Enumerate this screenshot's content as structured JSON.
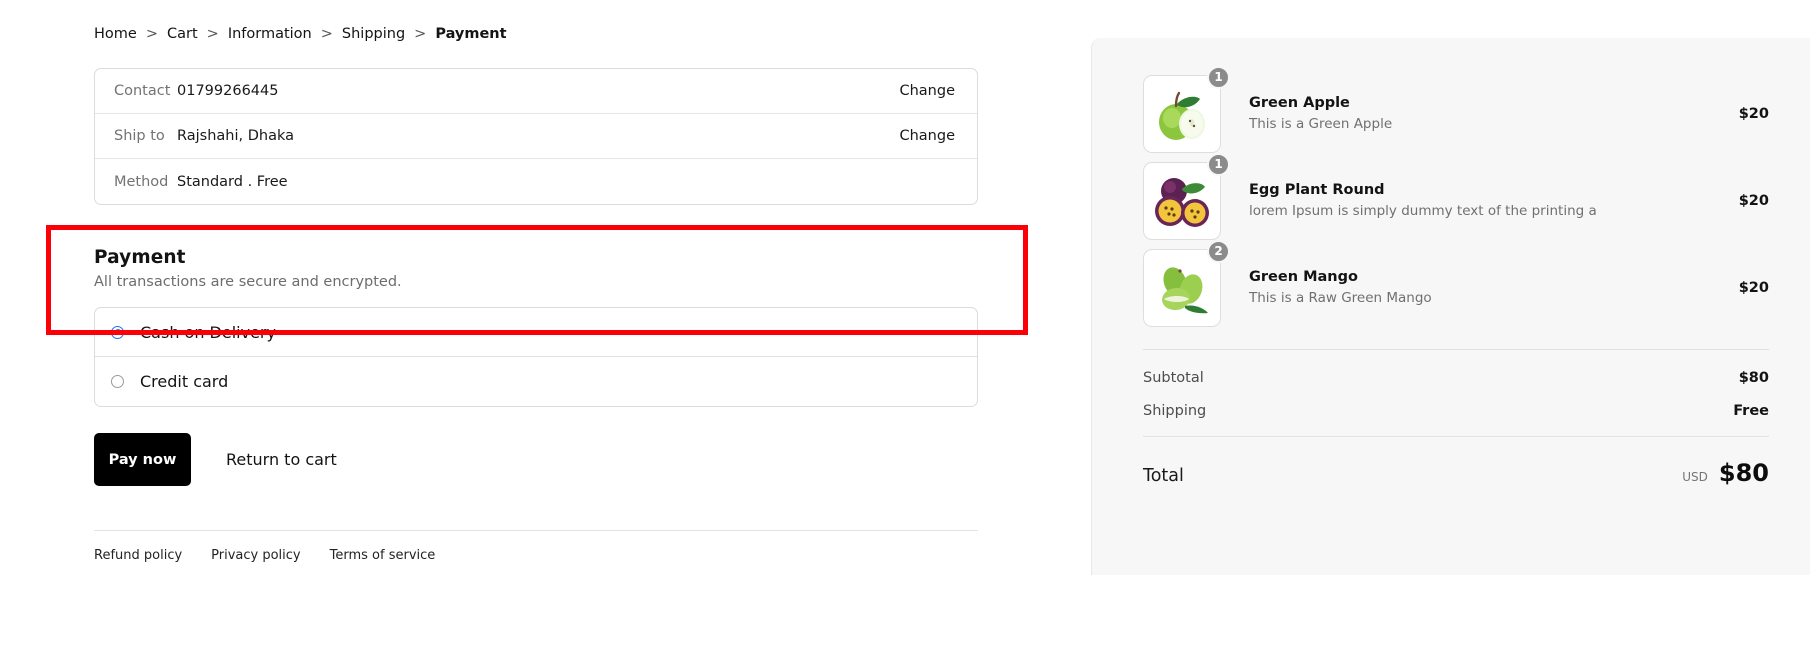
{
  "breadcrumb": {
    "separator": ">",
    "items": [
      {
        "label": "Home",
        "current": false
      },
      {
        "label": "Cart",
        "current": false
      },
      {
        "label": "Information",
        "current": false
      },
      {
        "label": "Shipping",
        "current": false
      },
      {
        "label": "Payment",
        "current": true
      }
    ]
  },
  "info": {
    "rows": [
      {
        "label": "Contact",
        "value": "01799266445",
        "action": "Change"
      },
      {
        "label": "Ship to",
        "value": "Rajshahi, Dhaka",
        "action": "Change"
      },
      {
        "label": "Method",
        "value": "Standard . Free",
        "action": ""
      }
    ]
  },
  "payment": {
    "title": "Payment",
    "subtitle": "All transactions are secure and encrypted.",
    "highlight_color": "#fb0007",
    "accent_color": "#1a73e8",
    "methods": [
      {
        "label": "Cash on Delivery",
        "selected": true
      },
      {
        "label": "Credit card",
        "selected": false
      }
    ]
  },
  "actions": {
    "pay_now_label": "Pay now",
    "return_to_cart_label": "Return to cart"
  },
  "footer": {
    "links": [
      {
        "label": "Refund policy"
      },
      {
        "label": "Privacy policy"
      },
      {
        "label": "Terms of service"
      }
    ]
  },
  "summary": {
    "items": [
      {
        "name": "Green Apple",
        "description": "This is a Green Apple",
        "quantity": "1",
        "price": "$20",
        "icon": "green-apple-image"
      },
      {
        "name": "Egg Plant Round",
        "description": "lorem Ipsum is simply dummy text of the printing a",
        "quantity": "1",
        "price": "$20",
        "icon": "egg-plant-round-image"
      },
      {
        "name": "Green Mango",
        "description": "This is a Raw Green Mango",
        "quantity": "2",
        "price": "$20",
        "icon": "green-mango-image"
      }
    ],
    "totals": [
      {
        "label": "Subtotal",
        "value": "$80"
      },
      {
        "label": "Shipping",
        "value": "Free"
      }
    ],
    "grand_total": {
      "label": "Total",
      "currency": "USD",
      "value": "$80"
    }
  }
}
